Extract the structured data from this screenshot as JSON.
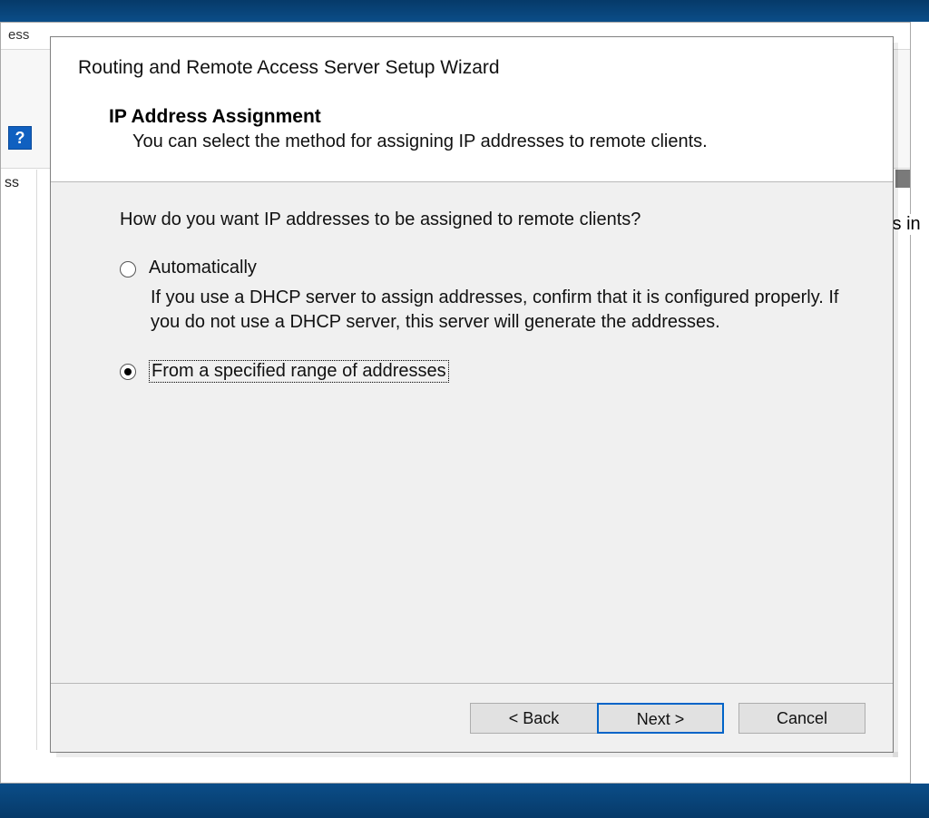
{
  "background": {
    "back_title_frag": "ess",
    "tree_frag": "ss",
    "help_icon_label": "?",
    "right_text_frag": "ts in"
  },
  "wizard": {
    "title": "Routing and Remote Access Server Setup Wizard",
    "subtitle": "IP Address Assignment",
    "subdesc": "You can select the method for assigning IP addresses to remote clients.",
    "question": "How do you want IP addresses to be assigned to remote clients?",
    "options": [
      {
        "label": "Automatically",
        "desc": "If you use a DHCP server to assign addresses, confirm that it is configured properly. If you do not use a DHCP server, this server will generate the addresses.",
        "selected": false
      },
      {
        "label": "From a specified range of addresses",
        "desc": "",
        "selected": true
      }
    ],
    "buttons": {
      "back": "< Back",
      "next": "Next >",
      "cancel": "Cancel"
    }
  }
}
